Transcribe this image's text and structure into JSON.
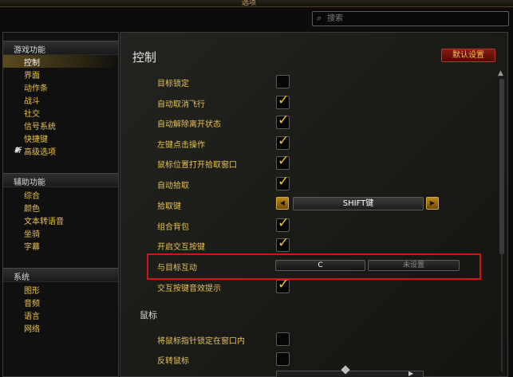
{
  "window": {
    "title": "选项"
  },
  "search": {
    "placeholder": "搜索"
  },
  "sidebar": {
    "sections": [
      {
        "header": "游戏功能",
        "items": [
          {
            "label": "控制",
            "selected": true
          },
          {
            "label": "界面"
          },
          {
            "label": "动作条"
          },
          {
            "label": "战斗"
          },
          {
            "label": "社交"
          },
          {
            "label": "信号系统"
          },
          {
            "label": "快捷键"
          },
          {
            "label": "高级选项",
            "badge": "新"
          }
        ]
      },
      {
        "header": "辅助功能",
        "items": [
          {
            "label": "综合"
          },
          {
            "label": "颜色"
          },
          {
            "label": "文本转语音"
          },
          {
            "label": "坐骑"
          },
          {
            "label": "字幕"
          }
        ]
      },
      {
        "header": "系统",
        "items": [
          {
            "label": "图形"
          },
          {
            "label": "音频"
          },
          {
            "label": "语言"
          },
          {
            "label": "网络"
          }
        ]
      }
    ]
  },
  "main": {
    "title": "控制",
    "defaults_button": "默认设置",
    "rows": [
      {
        "label": "目标锁定",
        "checked": false
      },
      {
        "label": "自动取消飞行",
        "checked": true
      },
      {
        "label": "自动解除离开状态",
        "checked": true
      },
      {
        "label": "左键点击操作",
        "checked": true
      },
      {
        "label": "鼠标位置打开拾取窗口",
        "checked": true
      },
      {
        "label": "自动拾取",
        "checked": true
      },
      {
        "label": "拾取键",
        "value": "SHIFT键"
      },
      {
        "label": "组合背包",
        "checked": true
      },
      {
        "label": "开启交互按键",
        "checked": true
      },
      {
        "label": "与目标互动",
        "binding_primary": "C",
        "binding_secondary": "未设置"
      },
      {
        "label": "交互按键音效提示",
        "checked": true
      }
    ],
    "mouse_section": {
      "header": "鼠标",
      "rows": [
        {
          "label": "将鼠标指针锁定在窗口内",
          "checked": false
        },
        {
          "label": "反转鼠标",
          "checked": false
        }
      ]
    }
  },
  "icons": {
    "search": "magnifier-icon",
    "check": "checkmark-icon",
    "arrow_left": "triangle-left-icon",
    "arrow_right": "triangle-right-icon",
    "scroll_up": "triangle-up-icon"
  },
  "colors": {
    "label_gold": "#e8c24c",
    "check_yellow": "#f4c61b",
    "highlight_red": "#d41414",
    "button_red": "#8a1a10"
  }
}
